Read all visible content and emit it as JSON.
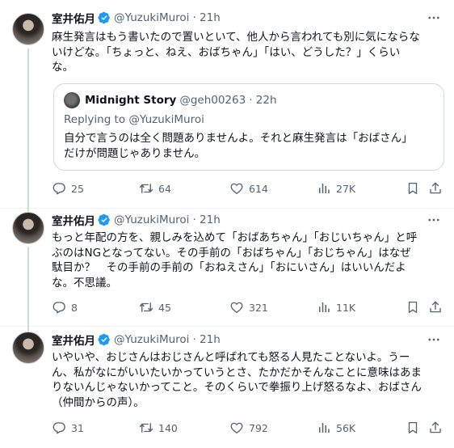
{
  "tweets": [
    {
      "name": "室井佑月",
      "handle": "@YuzukiMuroi",
      "time": "· 21h",
      "text": "麻生発言はもう書いたので置いといて、他人から言われても別に気にならな\nいけどな。「ちょっと、ねえ、おばちゃん」「はい、どうした？」くらい\nな。",
      "quote": {
        "name": "Midnight Story",
        "handle": "@geh00263",
        "time": "· 22h",
        "reply_to": "Replying to @YuzukiMuroi",
        "text": "自分で言うのは全く問題ありませんよ。それと麻生発言は「おばさん」\nだけが問題じゃありません。"
      },
      "replies": "25",
      "retweets": "64",
      "likes": "614",
      "views": "27K"
    },
    {
      "name": "室井佑月",
      "handle": "@YuzukiMuroi",
      "time": "· 21h",
      "text": "もっと年配の方を、親しみを込めて「おばあちゃん」「おじいちゃん」と呼\nぶのはNGとなってない。その手前の「おばちゃん」「おじちゃん」はなぜ\n駄目か？　その手前の手前の「おねえさん」「おにいさん」はいいんだよ\nな。不思議。",
      "replies": "8",
      "retweets": "45",
      "likes": "321",
      "views": "11K"
    },
    {
      "name": "室井佑月",
      "handle": "@YuzukiMuroi",
      "time": "· 21h",
      "text": "いやいや、おじさんはおじさんと呼ばれても怒る人見たことないよ。うー\nん、私がなにがいいたいかっていうとさ、たかだかそんなことに意味はあま\nりないんじゃないかってこと。そのくらいで拳振り上げ怒るなよ、おばさん\n（仲間からの声）。",
      "replies": "31",
      "retweets": "140",
      "likes": "792",
      "views": "56K"
    }
  ],
  "colors": {
    "verified": "#1d9bf0",
    "muted": "#536471",
    "text": "#0f1419",
    "border": "#cfd9de"
  },
  "icons": {
    "verified": "verified-badge-icon",
    "more": "more-horizontal-icon",
    "reply": "reply-icon",
    "retweet": "retweet-icon",
    "like": "heart-icon",
    "views": "views-chart-icon",
    "bookmark": "bookmark-icon",
    "share": "share-icon"
  }
}
